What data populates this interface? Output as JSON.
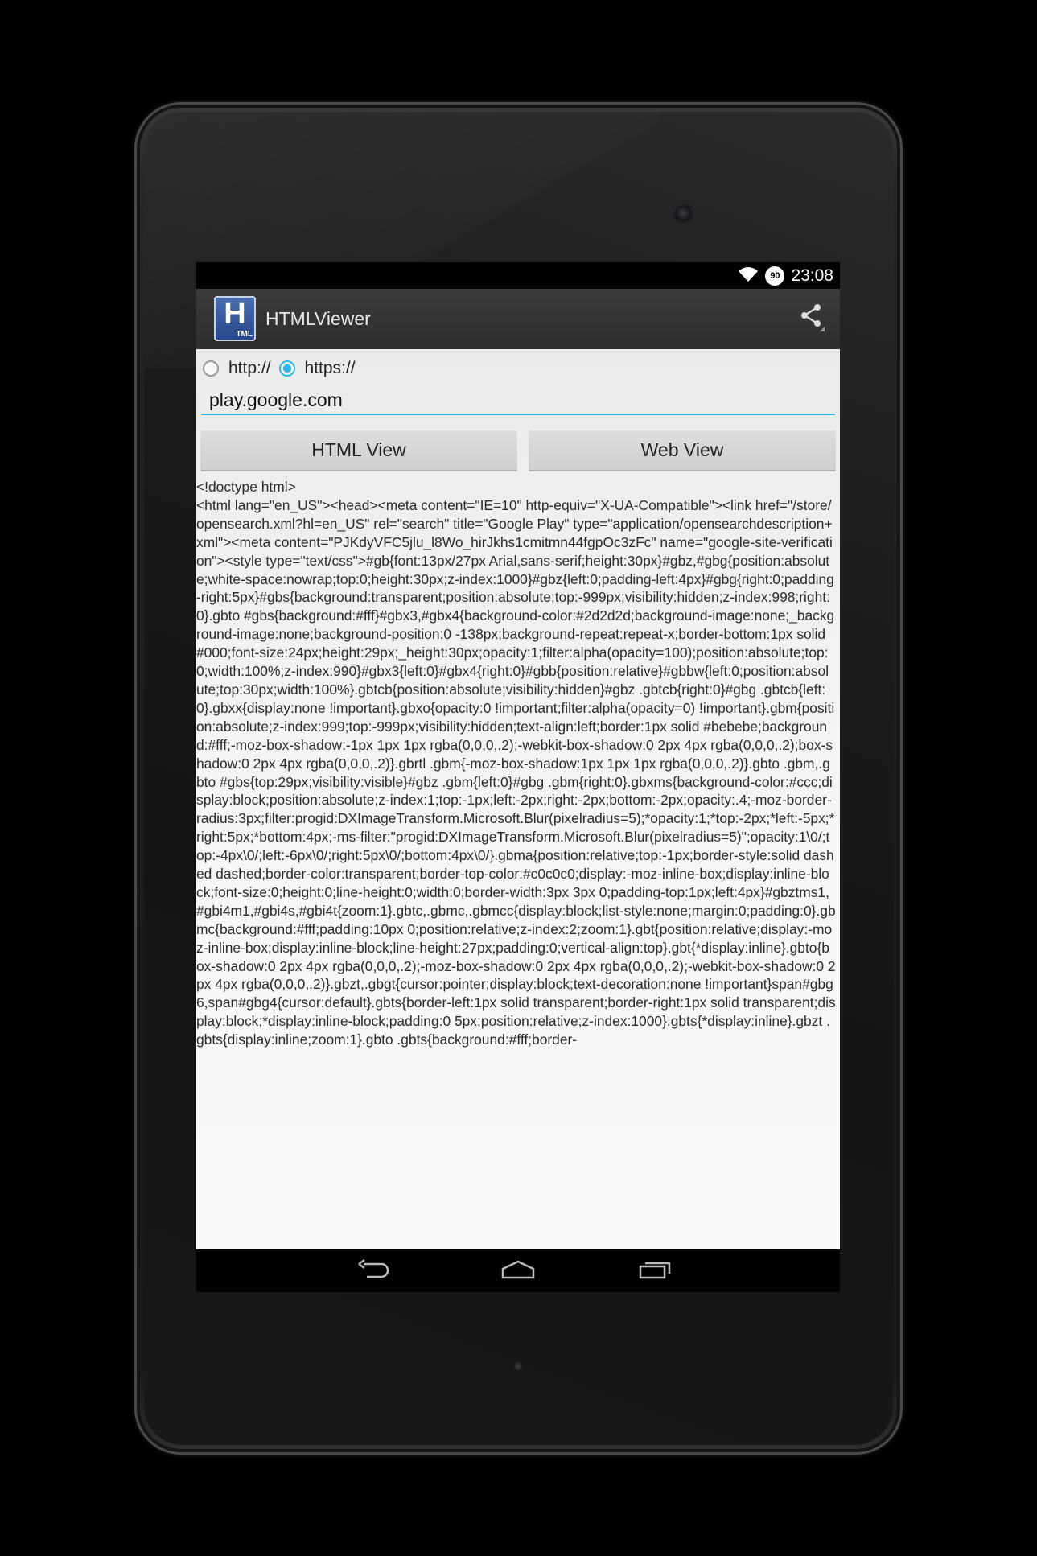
{
  "status_bar": {
    "time": "23:08",
    "battery": "90",
    "icons": [
      "wifi-icon",
      "battery-icon"
    ]
  },
  "action_bar": {
    "app_icon_text": "H",
    "app_icon_subtext": "TML",
    "title": "HTMLViewer",
    "share_icon": "share-icon"
  },
  "protocol": {
    "options": [
      {
        "label": "http://",
        "checked": false
      },
      {
        "label": "https://",
        "checked": true
      }
    ]
  },
  "url_field": {
    "value": "play.google.com"
  },
  "buttons": {
    "html_view": "HTML View",
    "web_view": "Web View"
  },
  "source_text": "<!doctype html>\n<html lang=\"en_US\"><head><meta content=\"IE=10\" http-equiv=\"X-UA-Compatible\"><link href=\"/store/opensearch.xml?hl=en_US\" rel=\"search\" title=\"Google Play\" type=\"application/opensearchdescription+xml\"><meta content=\"PJKdyVFC5jlu_l8Wo_hirJkhs1cmitmn44fgpOc3zFc\" name=\"google-site-verification\"><style type=\"text/css\">#gb{font:13px/27px Arial,sans-serif;height:30px}#gbz,#gbg{position:absolute;white-space:nowrap;top:0;height:30px;z-index:1000}#gbz{left:0;padding-left:4px}#gbg{right:0;padding-right:5px}#gbs{background:transparent;position:absolute;top:-999px;visibility:hidden;z-index:998;right:0}.gbto #gbs{background:#fff}#gbx3,#gbx4{background-color:#2d2d2d;background-image:none;_background-image:none;background-position:0 -138px;background-repeat:repeat-x;border-bottom:1px solid #000;font-size:24px;height:29px;_height:30px;opacity:1;filter:alpha(opacity=100);position:absolute;top:0;width:100%;z-index:990}#gbx3{left:0}#gbx4{right:0}#gbb{position:relative}#gbbw{left:0;position:absolute;top:30px;width:100%}.gbtcb{position:absolute;visibility:hidden}#gbz .gbtcb{right:0}#gbg .gbtcb{left:0}.gbxx{display:none !important}.gbxo{opacity:0 !important;filter:alpha(opacity=0) !important}.gbm{position:absolute;z-index:999;top:-999px;visibility:hidden;text-align:left;border:1px solid #bebebe;background:#fff;-moz-box-shadow:-1px 1px 1px rgba(0,0,0,.2);-webkit-box-shadow:0 2px 4px rgba(0,0,0,.2);box-shadow:0 2px 4px rgba(0,0,0,.2)}.gbrtl .gbm{-moz-box-shadow:1px 1px 1px rgba(0,0,0,.2)}.gbto .gbm,.gbto #gbs{top:29px;visibility:visible}#gbz .gbm{left:0}#gbg .gbm{right:0}.gbxms{background-color:#ccc;display:block;position:absolute;z-index:1;top:-1px;left:-2px;right:-2px;bottom:-2px;opacity:.4;-moz-border-radius:3px;filter:progid:DXImageTransform.Microsoft.Blur(pixelradius=5);*opacity:1;*top:-2px;*left:-5px;*right:5px;*bottom:4px;-ms-filter:\"progid:DXImageTransform.Microsoft.Blur(pixelradius=5)\";opacity:1\\0/;top:-4px\\0/;left:-6px\\0/;right:5px\\0/;bottom:4px\\0/}.gbma{position:relative;top:-1px;border-style:solid dashed dashed;border-color:transparent;border-top-color:#c0c0c0;display:-moz-inline-box;display:inline-block;font-size:0;height:0;line-height:0;width:0;border-width:3px 3px 0;padding-top:1px;left:4px}#gbztms1,#gbi4m1,#gbi4s,#gbi4t{zoom:1}.gbtc,.gbmc,.gbmcc{display:block;list-style:none;margin:0;padding:0}.gbmc{background:#fff;padding:10px 0;position:relative;z-index:2;zoom:1}.gbt{position:relative;display:-moz-inline-box;display:inline-block;line-height:27px;padding:0;vertical-align:top}.gbt{*display:inline}.gbto{box-shadow:0 2px 4px rgba(0,0,0,.2);-moz-box-shadow:0 2px 4px rgba(0,0,0,.2);-webkit-box-shadow:0 2px 4px rgba(0,0,0,.2)}.gbzt,.gbgt{cursor:pointer;display:block;text-decoration:none !important}span#gbg6,span#gbg4{cursor:default}.gbts{border-left:1px solid transparent;border-right:1px solid transparent;display:block;*display:inline-block;padding:0 5px;position:relative;z-index:1000}.gbts{*display:inline}.gbzt .gbts{display:inline;zoom:1}.gbto .gbts{background:#fff;border-",
  "nav_bar": {
    "icons": [
      "back-icon",
      "home-icon",
      "recent-apps-icon"
    ]
  },
  "colors": {
    "accent": "#33b5e5",
    "action_bar": "#333333",
    "status_bar": "#000000"
  }
}
